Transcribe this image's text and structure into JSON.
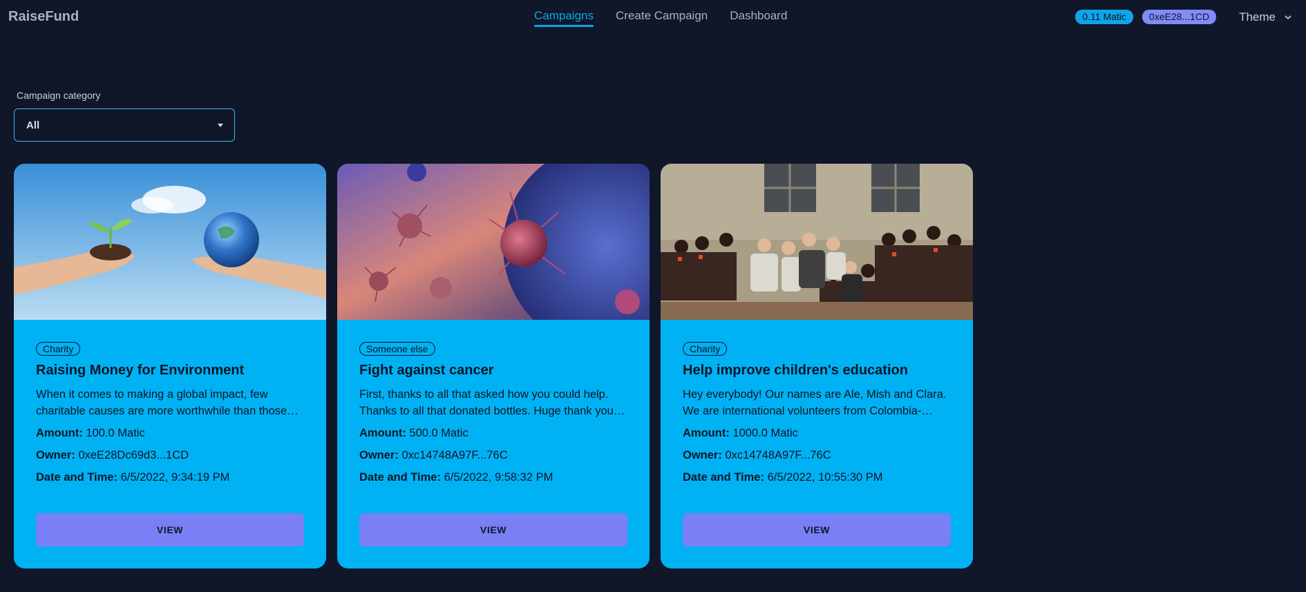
{
  "app": {
    "brand": "RaiseFund"
  },
  "nav": {
    "items": [
      {
        "label": "Campaigns",
        "active": true
      },
      {
        "label": "Create Campaign",
        "active": false
      },
      {
        "label": "Dashboard",
        "active": false
      }
    ]
  },
  "account": {
    "balance": "0.11 Matic",
    "address": "0xeE28...1CD",
    "theme_label": "Theme"
  },
  "filter": {
    "label": "Campaign category",
    "selected": "All"
  },
  "labels": {
    "amount": "Amount:",
    "owner": "Owner:",
    "datetime": "Date and Time:",
    "view": "VIEW"
  },
  "campaigns": [
    {
      "category": "Charity",
      "title": "Raising Money for Environment",
      "description": "When it comes to making a global impact, few charitable causes are more worthwhile than those…",
      "amount": "100.0 Matic",
      "owner": "0xeE28Dc69d3...1CD",
      "datetime": "6/5/2022, 9:34:19 PM",
      "image": "hands-holding-plant-and-earth"
    },
    {
      "category": "Someone else",
      "title": "Fight against cancer",
      "description": "First, thanks to all that asked how you could help. Thanks to all that donated bottles. Huge thank you t…",
      "amount": "500.0 Matic",
      "owner": "0xc14748A97F...76C",
      "datetime": "6/5/2022, 9:58:32 PM",
      "image": "cancer-cells-illustration"
    },
    {
      "category": "Charity",
      "title": "Help improve children's education",
      "description": "Hey everybody! Our names are Ale, Mish and Clara. We are international volunteers from Colombia-…",
      "amount": "1000.0 Matic",
      "owner": "0xc14748A97F...76C",
      "datetime": "6/5/2022, 10:55:30 PM",
      "image": "school-children-group-photo"
    }
  ]
}
